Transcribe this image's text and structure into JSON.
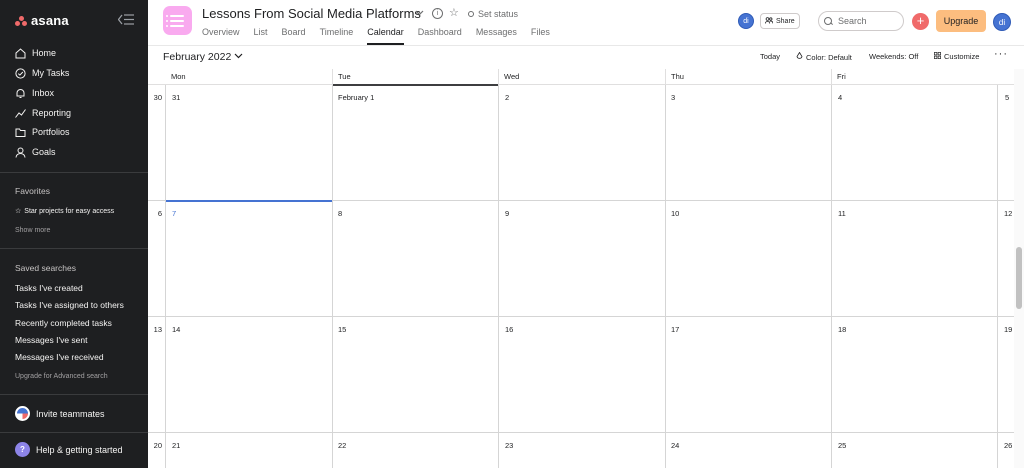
{
  "sidebar": {
    "logo": "asana",
    "nav": [
      {
        "label": "Home",
        "icon": "home-icon"
      },
      {
        "label": "My Tasks",
        "icon": "check-circle-icon"
      },
      {
        "label": "Inbox",
        "icon": "bell-icon"
      },
      {
        "label": "Reporting",
        "icon": "chart-line-icon"
      },
      {
        "label": "Portfolios",
        "icon": "folder-icon"
      },
      {
        "label": "Goals",
        "icon": "person-icon"
      }
    ],
    "favorites_label": "Favorites",
    "star_projects": "Star projects for easy access",
    "show_more": "Show more",
    "saved_searches_label": "Saved searches",
    "saved_searches": [
      "Tasks I've created",
      "Tasks I've assigned to others",
      "Recently completed tasks",
      "Messages I've sent",
      "Messages I've received"
    ],
    "upgrade_advanced": "Upgrade for Advanced search",
    "invite": "Invite teammates",
    "help": "Help & getting started"
  },
  "header": {
    "project_title": "Lessons From Social Media Platforms",
    "set_status": "Set status",
    "tabs": [
      "Overview",
      "List",
      "Board",
      "Timeline",
      "Calendar",
      "Dashboard",
      "Messages",
      "Files"
    ],
    "active_tab": "Calendar",
    "avatar_initials": "di",
    "share": "Share",
    "search_placeholder": "Search",
    "upgrade": "Upgrade",
    "add": "+"
  },
  "toolbar": {
    "month": "February 2022",
    "today": "Today",
    "color": "Color: Default",
    "weekends": "Weekends: Off",
    "customize": "Customize"
  },
  "calendar": {
    "days": [
      "Mon",
      "Tue",
      "Wed",
      "Thu",
      "Fri"
    ],
    "weeks": [
      {
        "week": "30",
        "dates": [
          "31",
          "February 1",
          "2",
          "3",
          "4"
        ],
        "end": "5"
      },
      {
        "week": "6",
        "dates": [
          "7",
          "8",
          "9",
          "10",
          "11"
        ],
        "end": "12"
      },
      {
        "week": "13",
        "dates": [
          "14",
          "15",
          "16",
          "17",
          "18"
        ],
        "end": "19"
      },
      {
        "week": "20",
        "dates": [
          "21",
          "22",
          "23",
          "24",
          "25"
        ],
        "end": "26"
      }
    ],
    "today_date": "7"
  },
  "colors": {
    "sidebar_bg": "#1e1f21",
    "accent_blue": "#4573d2",
    "brand_coral": "#f06a6a",
    "upgrade_bg": "#fcbd7f",
    "project_icon_bg": "#f9aaef"
  }
}
